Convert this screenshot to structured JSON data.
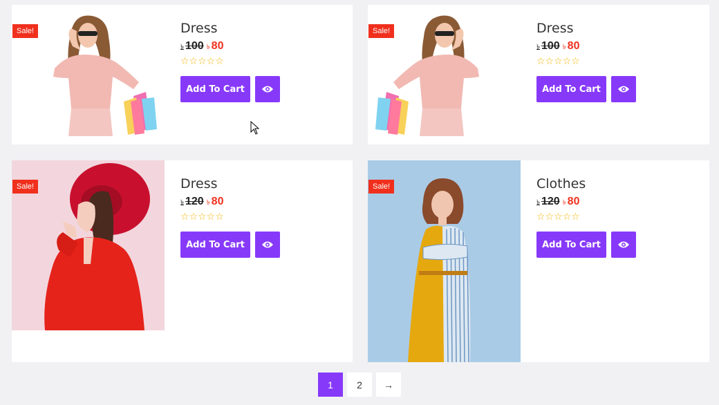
{
  "products": [
    {
      "title": "Dress",
      "badge": "Sale!",
      "currency": "৳",
      "old_price": "100",
      "new_price": "80",
      "rating": "☆☆☆☆☆",
      "cart_label": "Add To Cart"
    },
    {
      "title": "Dress",
      "badge": "Sale!",
      "currency": "৳",
      "old_price": "100",
      "new_price": "80",
      "rating": "☆☆☆☆☆",
      "cart_label": "Add To Cart"
    },
    {
      "title": "Dress",
      "badge": "Sale!",
      "currency": "৳",
      "old_price": "120",
      "new_price": "80",
      "rating": "☆☆☆☆☆",
      "cart_label": "Add To Cart"
    },
    {
      "title": "Clothes",
      "badge": "Sale!",
      "currency": "৳",
      "old_price": "120",
      "new_price": "80",
      "rating": "☆☆☆☆☆",
      "cart_label": "Add To Cart"
    }
  ],
  "pagination": {
    "pages": [
      "1",
      "2"
    ],
    "next": "→",
    "current": "1"
  },
  "colors": {
    "accent": "#8739f9",
    "sale": "#f0301d",
    "star": "#f3b500"
  },
  "icons": {
    "view": "eye-icon"
  }
}
